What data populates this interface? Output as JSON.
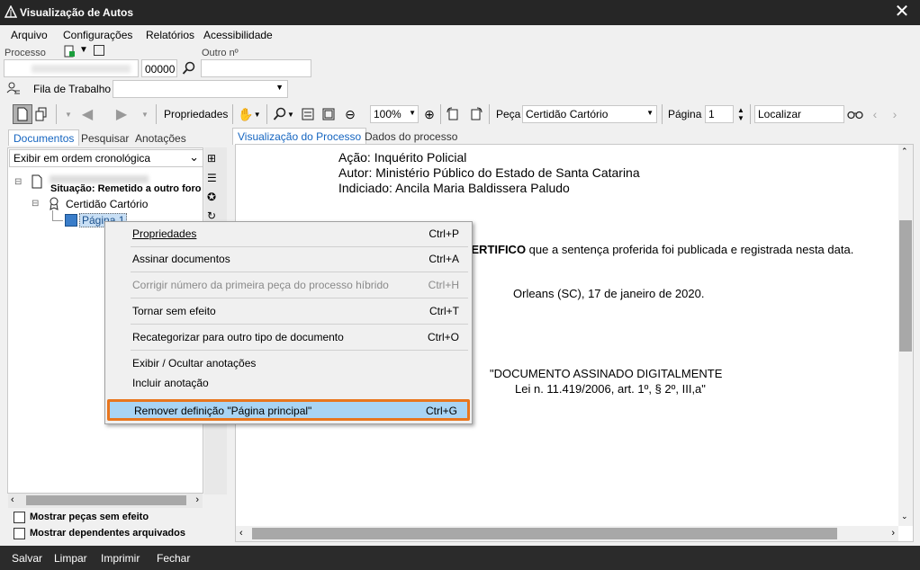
{
  "window": {
    "title": "Visualização de Autos"
  },
  "menu": {
    "arquivo": "Arquivo",
    "configuracoes": "Configurações",
    "relatorios": "Relatórios",
    "acessibilidade": "Acessibilidade"
  },
  "header": {
    "processo_label": "Processo",
    "outro_label": "Outro nº",
    "proc_suffix": "00000",
    "fila_label": "Fila de Trabalho"
  },
  "toolbar": {
    "propriedades": "Propriedades",
    "zoom": "100%",
    "peca_label": "Peça",
    "peca_value": "Certidão Cartório",
    "pagina_label": "Página",
    "pagina_value": "1",
    "localizar": "Localizar"
  },
  "left_tabs": [
    "Documentos",
    "Pesquisar",
    "Anotações"
  ],
  "order_select": "Exibir em ordem cronológica",
  "tree": {
    "situacao": "Situação: Remetido a outro foro",
    "certidao": "Certidão Cartório",
    "pagina": "Página 1"
  },
  "checkboxes": {
    "sem_efeito": "Mostrar peças sem efeito",
    "dependentes": "Mostrar dependentes arquivados"
  },
  "view_tabs": [
    "Visualização do Processo",
    "Dados do processo"
  ],
  "document": {
    "acao": "Ação: Inquérito Policial",
    "autor": "Autor: Ministério Público do Estado de Santa Catarina",
    "indiciado": "Indiciado: Ancila Maria Baldissera Paludo",
    "certifico_bold": "CERTIFICO",
    "certifico_rest": " que a sentença proferida foi publicada e registrada nesta data.",
    "local_data": "Orleans (SC), 17 de janeiro de 2020.",
    "assinado": "\"DOCUMENTO ASSINADO DIGITALMENTE",
    "lei": "Lei n. 11.419/2006, art. 1º, § 2º, III,a\""
  },
  "context_menu": [
    {
      "label": "Propriedades",
      "shortcut": "Ctrl+P"
    },
    {
      "label": "Assinar documentos",
      "shortcut": "Ctrl+A"
    },
    {
      "label": "Corrigir número da primeira peça do processo híbrido",
      "shortcut": "Ctrl+H"
    },
    {
      "label": "Tornar sem efeito",
      "shortcut": "Ctrl+T"
    },
    {
      "label": "Recategorizar para outro tipo de documento",
      "shortcut": "Ctrl+O"
    },
    {
      "label": "Exibir / Ocultar anotações",
      "shortcut": ""
    },
    {
      "label": "Incluir anotação",
      "shortcut": ""
    },
    {
      "label": "Remover definição \"Página principal\"",
      "shortcut": "Ctrl+G"
    }
  ],
  "footer": {
    "salvar": "Salvar",
    "limpar": "Limpar",
    "imprimir": "Imprimir",
    "fechar": "Fechar"
  },
  "colors": {
    "titlebar": "#262626",
    "highlight_border": "#e8761e",
    "highlight_bg": "#a8d4f4",
    "tab_active": "#1565c0"
  }
}
